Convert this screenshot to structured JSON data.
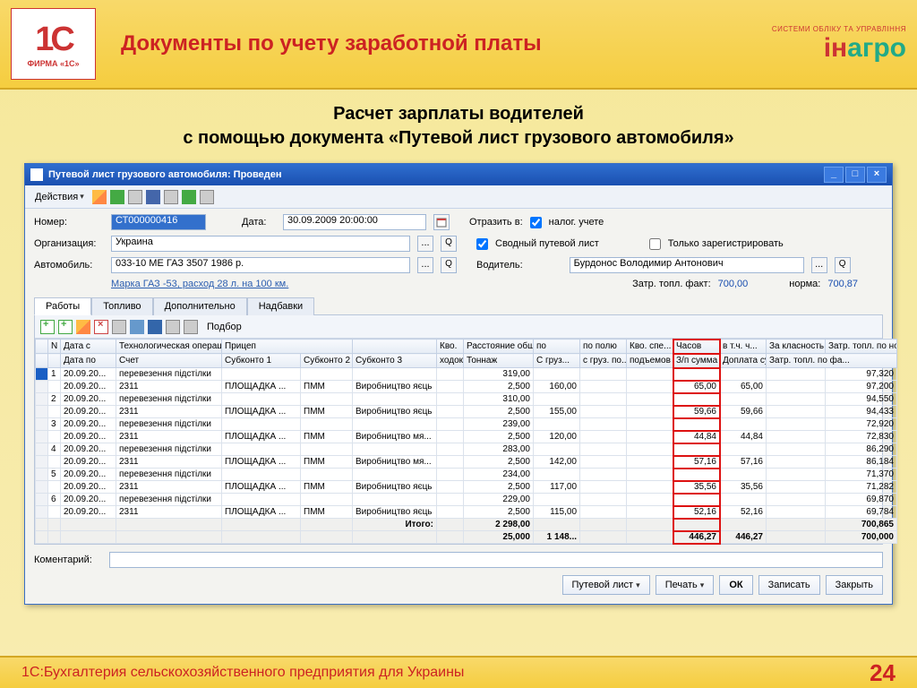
{
  "slide": {
    "company_logo": "ФИРМА «1С»",
    "company_logo_top": "1С",
    "title": "Документы по учету заработной платы",
    "doc_title1": "Расчет зарплаты водителей",
    "doc_title2": "с помощью документа «Путевой лист грузового автомобиля»",
    "footer": "1С:Бухгалтерия сельскохозяйственного предприятия для Украины",
    "number": "24",
    "right_logo_sub": "СИСТЕМИ ОБЛІКУ ТА УПРАВЛІННЯ",
    "right_logo_in": "ін",
    "right_logo_agro": "агро"
  },
  "window": {
    "title": "Путевой лист грузового автомобиля: Проведен",
    "actions_label": "Действия",
    "labels": {
      "number": "Номер:",
      "date": "Дата:",
      "reflect": "Отразить в:",
      "org": "Организация:",
      "auto": "Автомобиль:",
      "driver": "Водитель:",
      "tax": "налог. учете",
      "summary": "Сводный путевой лист",
      "only_reg": "Только зарегистрировать",
      "fuel_fact": "Затр. топл. факт:",
      "fuel_norm": "норма:",
      "comment": "Коментарий:"
    },
    "values": {
      "number": "СТ000000416",
      "date": "30.09.2009 20:00:00",
      "org": "Украина",
      "auto": "033-10 МЕ  ГАЗ 3507  1986 р.",
      "auto_hint": "Марка ГАЗ -53, расход 28 л. на 100 км.",
      "driver": "Бурдонос Володимир Антонович",
      "fuel_fact": "700,00",
      "fuel_norm": "700,87"
    },
    "tabs": [
      "Работы",
      "Топливо",
      "Дополнительно",
      "Надбавки"
    ],
    "grid": {
      "podb": "Подбор",
      "headers1": [
        "N",
        "Дата с",
        "Технологическая операция",
        "Прицеп",
        "",
        "Кво.",
        "Расстояние общ.",
        "по",
        "по полю",
        "Кво. спе...",
        "Часов",
        "в т.ч. ч...",
        "За класность",
        "Затр. топл. по нор..."
      ],
      "headers2": [
        "",
        "Дата по",
        "Счет",
        "Субконто 1",
        "Субконто 2",
        "Субконто 3",
        "ходок",
        "Тоннаж",
        "С груз...",
        "с груз. по...",
        "подъемов",
        "З/п сумма",
        "Доплата сум...",
        "Затр. топл. по фа..."
      ],
      "rows": [
        {
          "n": "1",
          "d": "20.09.20...",
          "op": "перевезення підстілки",
          "sub1": "",
          "sub2": "",
          "sub3": "",
          "kv": "",
          "g1": "319,00",
          "g2": "",
          "g3": "",
          "g4": "",
          "c1": "",
          "c2": "",
          "c3": "",
          "c4": "97,320"
        },
        {
          "n": "",
          "d": "20.09.20...",
          "op": "2311",
          "sub1": "ПЛОЩАДКА ...",
          "sub2": "ПММ",
          "sub3": "Виробництво яєць",
          "kv": "",
          "g1": "2,500",
          "g2": "160,00",
          "g3": "",
          "g4": "",
          "c1": "65,00",
          "c2": "65,00",
          "c3": "",
          "c4": "97,200"
        },
        {
          "n": "2",
          "d": "20.09.20...",
          "op": "перевезення підстілки",
          "sub1": "",
          "sub2": "",
          "sub3": "",
          "kv": "",
          "g1": "310,00",
          "g2": "",
          "g3": "",
          "g4": "",
          "c1": "",
          "c2": "",
          "c3": "",
          "c4": "94,550"
        },
        {
          "n": "",
          "d": "20.09.20...",
          "op": "2311",
          "sub1": "ПЛОЩАДКА ...",
          "sub2": "ПММ",
          "sub3": "Виробництво яєць",
          "kv": "",
          "g1": "2,500",
          "g2": "155,00",
          "g3": "",
          "g4": "",
          "c1": "59,66",
          "c2": "59,66",
          "c3": "",
          "c4": "94,433"
        },
        {
          "n": "3",
          "d": "20.09.20...",
          "op": "перевезення підстілки",
          "sub1": "",
          "sub2": "",
          "sub3": "",
          "kv": "",
          "g1": "239,00",
          "g2": "",
          "g3": "",
          "g4": "",
          "c1": "",
          "c2": "",
          "c3": "",
          "c4": "72,920"
        },
        {
          "n": "",
          "d": "20.09.20...",
          "op": "2311",
          "sub1": "ПЛОЩАДКА ...",
          "sub2": "ПММ",
          "sub3": "Виробництво мя...",
          "kv": "",
          "g1": "2,500",
          "g2": "120,00",
          "g3": "",
          "g4": "",
          "c1": "44,84",
          "c2": "44,84",
          "c3": "",
          "c4": "72,830"
        },
        {
          "n": "4",
          "d": "20.09.20...",
          "op": "перевезення підстілки",
          "sub1": "",
          "sub2": "",
          "sub3": "",
          "kv": "",
          "g1": "283,00",
          "g2": "",
          "g3": "",
          "g4": "",
          "c1": "",
          "c2": "",
          "c3": "",
          "c4": "86,290"
        },
        {
          "n": "",
          "d": "20.09.20...",
          "op": "2311",
          "sub1": "ПЛОЩАДКА ...",
          "sub2": "ПММ",
          "sub3": "Виробництво мя...",
          "kv": "",
          "g1": "2,500",
          "g2": "142,00",
          "g3": "",
          "g4": "",
          "c1": "57,16",
          "c2": "57,16",
          "c3": "",
          "c4": "86,184"
        },
        {
          "n": "5",
          "d": "20.09.20...",
          "op": "перевезення підстілки",
          "sub1": "",
          "sub2": "",
          "sub3": "",
          "kv": "",
          "g1": "234,00",
          "g2": "",
          "g3": "",
          "g4": "",
          "c1": "",
          "c2": "",
          "c3": "",
          "c4": "71,370"
        },
        {
          "n": "",
          "d": "20.09.20...",
          "op": "2311",
          "sub1": "ПЛОЩАДКА ...",
          "sub2": "ПММ",
          "sub3": "Виробництво яєць",
          "kv": "",
          "g1": "2,500",
          "g2": "117,00",
          "g3": "",
          "g4": "",
          "c1": "35,56",
          "c2": "35,56",
          "c3": "",
          "c4": "71,282"
        },
        {
          "n": "6",
          "d": "20.09.20...",
          "op": "перевезення підстілки",
          "sub1": "",
          "sub2": "",
          "sub3": "",
          "kv": "",
          "g1": "229,00",
          "g2": "",
          "g3": "",
          "g4": "",
          "c1": "",
          "c2": "",
          "c3": "",
          "c4": "69,870"
        },
        {
          "n": "",
          "d": "20.09.20...",
          "op": "2311",
          "sub1": "ПЛОЩАДКА ...",
          "sub2": "ПММ",
          "sub3": "Виробництво яєць",
          "kv": "",
          "g1": "2,500",
          "g2": "115,00",
          "g3": "",
          "g4": "",
          "c1": "52,16",
          "c2": "52,16",
          "c3": "",
          "c4": "69,784"
        }
      ],
      "total_label": "Итого:",
      "totals1": {
        "g1": "2 298,00",
        "c1": "",
        "c4": "700,865"
      },
      "totals2": {
        "g1": "25,000",
        "g2": "1 148...",
        "c1": "446,27",
        "c2": "446,27",
        "c4": "700,000"
      }
    },
    "buttons": {
      "waybill": "Путевой лист",
      "print": "Печать",
      "ok": "ОК",
      "save": "Записать",
      "close": "Закрыть"
    }
  }
}
